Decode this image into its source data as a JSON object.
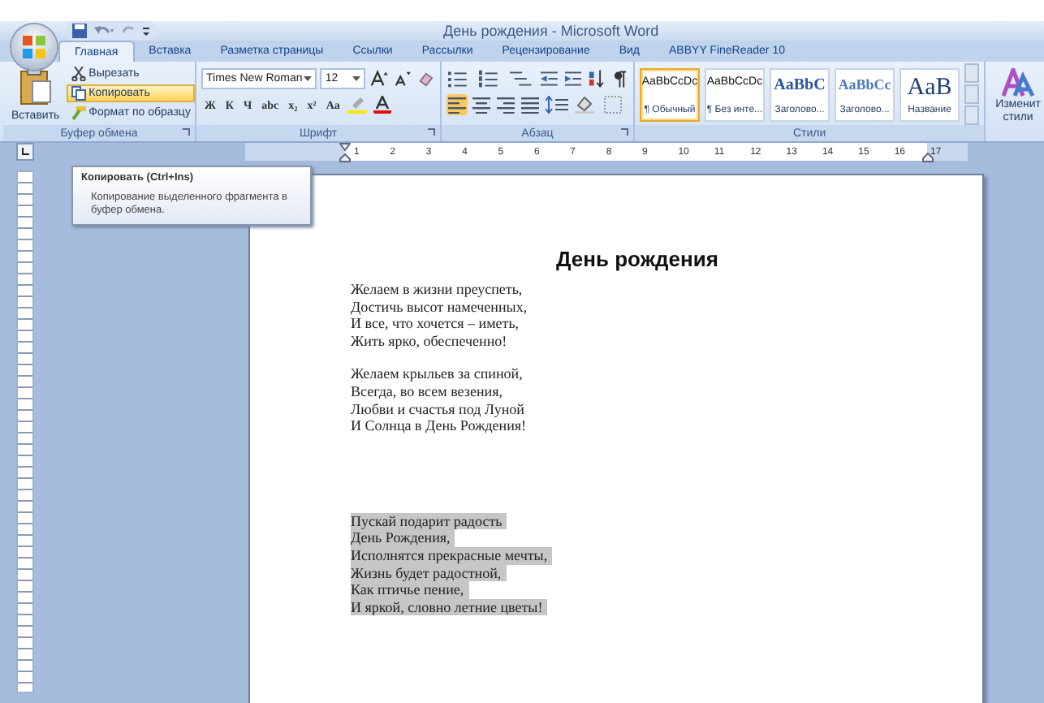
{
  "window": {
    "title": "День рождения - Microsoft Word"
  },
  "tabs": [
    {
      "label": "Главная",
      "selected": true
    },
    {
      "label": "Вставка",
      "selected": false
    },
    {
      "label": "Разметка страницы",
      "selected": false
    },
    {
      "label": "Ссылки",
      "selected": false
    },
    {
      "label": "Рассылки",
      "selected": false
    },
    {
      "label": "Рецензирование",
      "selected": false
    },
    {
      "label": "Вид",
      "selected": false
    },
    {
      "label": "ABBYY FineReader 10",
      "selected": false
    }
  ],
  "clipboard": {
    "group": "Буфер обмена",
    "paste": "Вставить",
    "actions": [
      {
        "label": "Вырезать",
        "kind": "cut",
        "selected": false
      },
      {
        "label": "Копировать",
        "kind": "copy",
        "selected": true
      },
      {
        "label": "Формат по образцу",
        "kind": "brush",
        "selected": false
      }
    ]
  },
  "font": {
    "group": "Шрифт",
    "name": "Times New Roman",
    "size": "12",
    "format_buttons": [
      "Ж",
      "К",
      "Ч",
      "abc",
      "x₂",
      "x²",
      "Aa"
    ]
  },
  "paragraph": {
    "group": "Абзац"
  },
  "styles": {
    "group": "Стили",
    "items": [
      {
        "preview": "AaBbCcDc",
        "name": "¶ Обычный",
        "kind": "normal",
        "selected": true
      },
      {
        "preview": "AaBbCcDc",
        "name": "¶ Без инте...",
        "kind": "normal",
        "selected": false
      },
      {
        "preview": "AaBbC",
        "name": "Заголово...",
        "kind": "heading1",
        "selected": false
      },
      {
        "preview": "AaBbCc",
        "name": "Заголово...",
        "kind": "heading2",
        "selected": false
      },
      {
        "preview": "AaB",
        "name": "Название",
        "kind": "title",
        "selected": false
      }
    ],
    "change_styles": [
      "Изменит",
      "стили"
    ]
  },
  "tooltip": {
    "title": "Копировать (Ctrl+Ins)",
    "text": "Копирование выделенного фрагмента в буфер обмена."
  },
  "ruler": [
    "1",
    "2",
    "3",
    "4",
    "5",
    "6",
    "7",
    "8",
    "9",
    "10",
    "11",
    "12",
    "13",
    "14",
    "15",
    "16",
    "17"
  ],
  "document": {
    "title": "День рождения",
    "stanzas": [
      {
        "selected": false,
        "lines": [
          "Желаем в жизни преуспеть,",
          "Достичь высот намеченных,",
          "И все, что хочется – иметь,",
          "Жить ярко, обеспеченно!"
        ]
      },
      {
        "selected": false,
        "lines": [
          "Желаем крыльев за  спиной,",
          "Всегда, во всем везения,",
          "Любви и счастья под Луной",
          "И Солнца в День Рождения!"
        ]
      },
      {
        "selected": true,
        "lines": [
          "Пускай подарит радость",
          "День Рождения,",
          "Исполнятся прекрасные мечты,",
          "Жизнь будет радостной,",
          "Как птичье пение,",
          "И яркой, словно летние цветы!"
        ]
      }
    ]
  }
}
